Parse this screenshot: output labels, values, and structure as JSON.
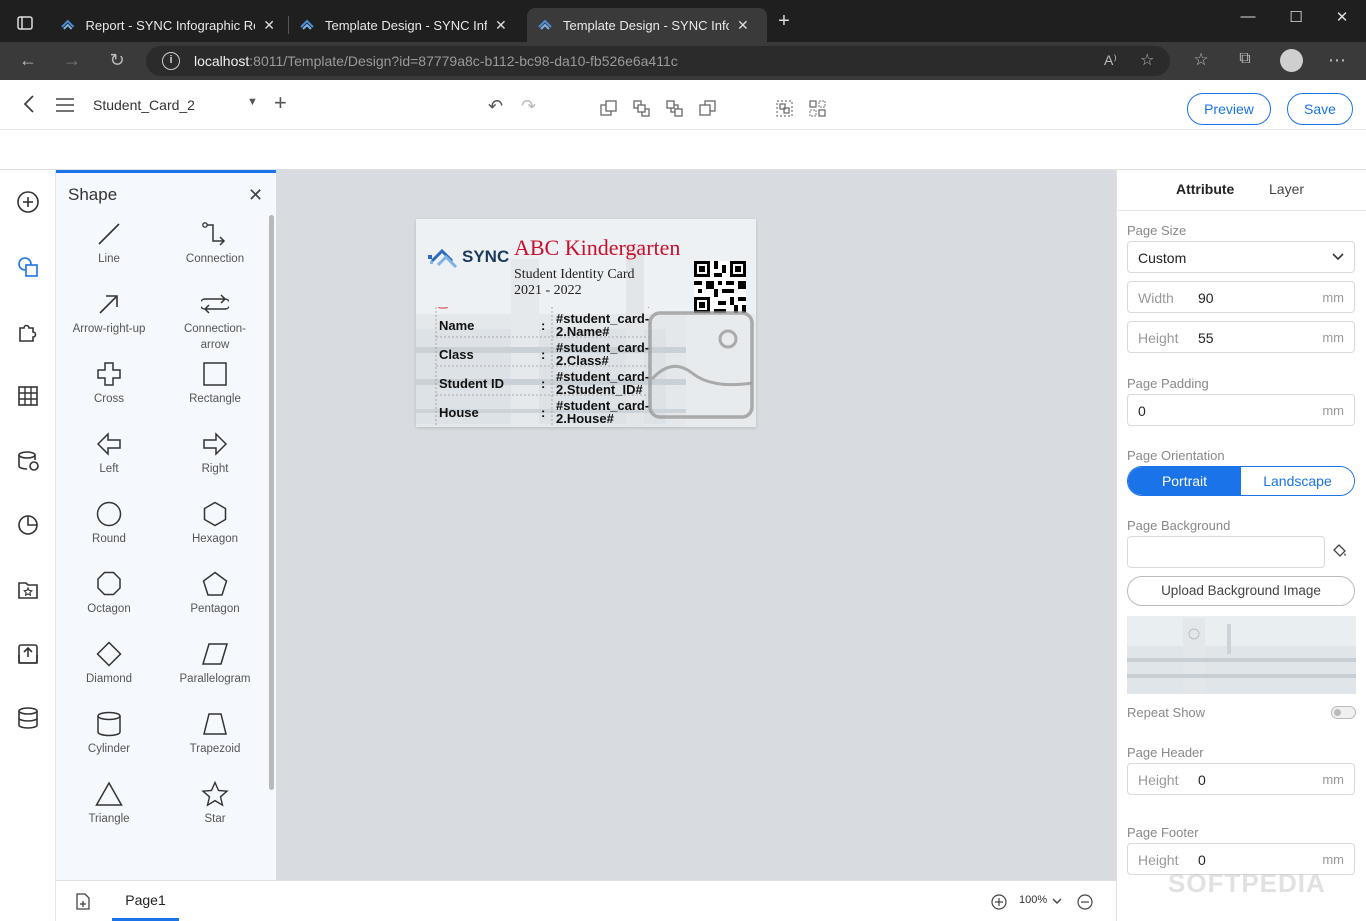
{
  "browser": {
    "tabs": [
      {
        "label": "Report - SYNC Infographic Report",
        "active": false
      },
      {
        "label": "Template Design - SYNC Infographic",
        "active": false
      },
      {
        "label": "Template Design - SYNC Infographic",
        "active": true
      }
    ],
    "url_host": "localhost",
    "url_rest": ":8011/Template/Design?id=87779a8c-b112-bc98-da10-fb526e6a411c"
  },
  "toolbar": {
    "doc_name": "Student_Card_2",
    "preview_label": "Preview",
    "save_label": "Save"
  },
  "shape_panel": {
    "title": "Shape",
    "items": [
      {
        "label": "Line",
        "icon": "line-icon"
      },
      {
        "label": "Connection",
        "icon": "connection-icon"
      },
      {
        "label": "Arrow-right-up",
        "icon": "arrow-right-up-icon"
      },
      {
        "label": "Connection-arrow",
        "icon": "connection-arrow-icon"
      },
      {
        "label": "Cross",
        "icon": "cross-icon"
      },
      {
        "label": "Rectangle",
        "icon": "rectangle-icon"
      },
      {
        "label": "Left",
        "icon": "left-arrow-icon"
      },
      {
        "label": "Right",
        "icon": "right-arrow-icon"
      },
      {
        "label": "Round",
        "icon": "circle-icon"
      },
      {
        "label": "Hexagon",
        "icon": "hexagon-icon"
      },
      {
        "label": "Octagon",
        "icon": "octagon-icon"
      },
      {
        "label": "Pentagon",
        "icon": "pentagon-icon"
      },
      {
        "label": "Diamond",
        "icon": "diamond-icon"
      },
      {
        "label": "Parallelogram",
        "icon": "parallelogram-icon"
      },
      {
        "label": "Cylinder",
        "icon": "cylinder-icon"
      },
      {
        "label": "Trapezoid",
        "icon": "trapezoid-icon"
      },
      {
        "label": "Triangle",
        "icon": "triangle-icon"
      },
      {
        "label": "Star",
        "icon": "star-icon"
      }
    ]
  },
  "card": {
    "logo_text": "SYNC",
    "title": "ABC Kindergarten",
    "subtitle": "Student Identity Card",
    "year": "2021 - 2022",
    "fields": [
      {
        "label": "Name",
        "value": "#student_card-2.Name#"
      },
      {
        "label": "Class",
        "value": "#student_card-2.Class#"
      },
      {
        "label": "Student ID",
        "value": "#student_card-2.Student_ID#"
      },
      {
        "label": "House",
        "value": "#student_card-2.House#"
      }
    ],
    "colon": ":"
  },
  "right_panel": {
    "tabs": [
      "Attribute",
      "Layer"
    ],
    "page_size_label": "Page Size",
    "page_size_value": "Custom",
    "width_label": "Width",
    "width_value": "90",
    "height_label": "Height",
    "height_value": "55",
    "unit": "mm",
    "padding_label": "Page Padding",
    "padding_value": "0",
    "orientation_label": "Page Orientation",
    "orientation_options": [
      "Portrait",
      "Landscape"
    ],
    "background_label": "Page Background",
    "upload_label": "Upload Background Image",
    "repeat_label": "Repeat Show",
    "header_label": "Page Header",
    "header_height_label": "Height",
    "header_height_value": "0",
    "footer_label": "Page Footer",
    "footer_height_label": "Height",
    "footer_height_value": "0"
  },
  "bottom": {
    "page_tab": "Page1",
    "zoom": "100%"
  },
  "watermark": "SOFTPEDIA",
  "colors": {
    "accent": "#1a73e8",
    "card_title": "#c8102e",
    "canvas_bg": "#d8dbe0"
  }
}
